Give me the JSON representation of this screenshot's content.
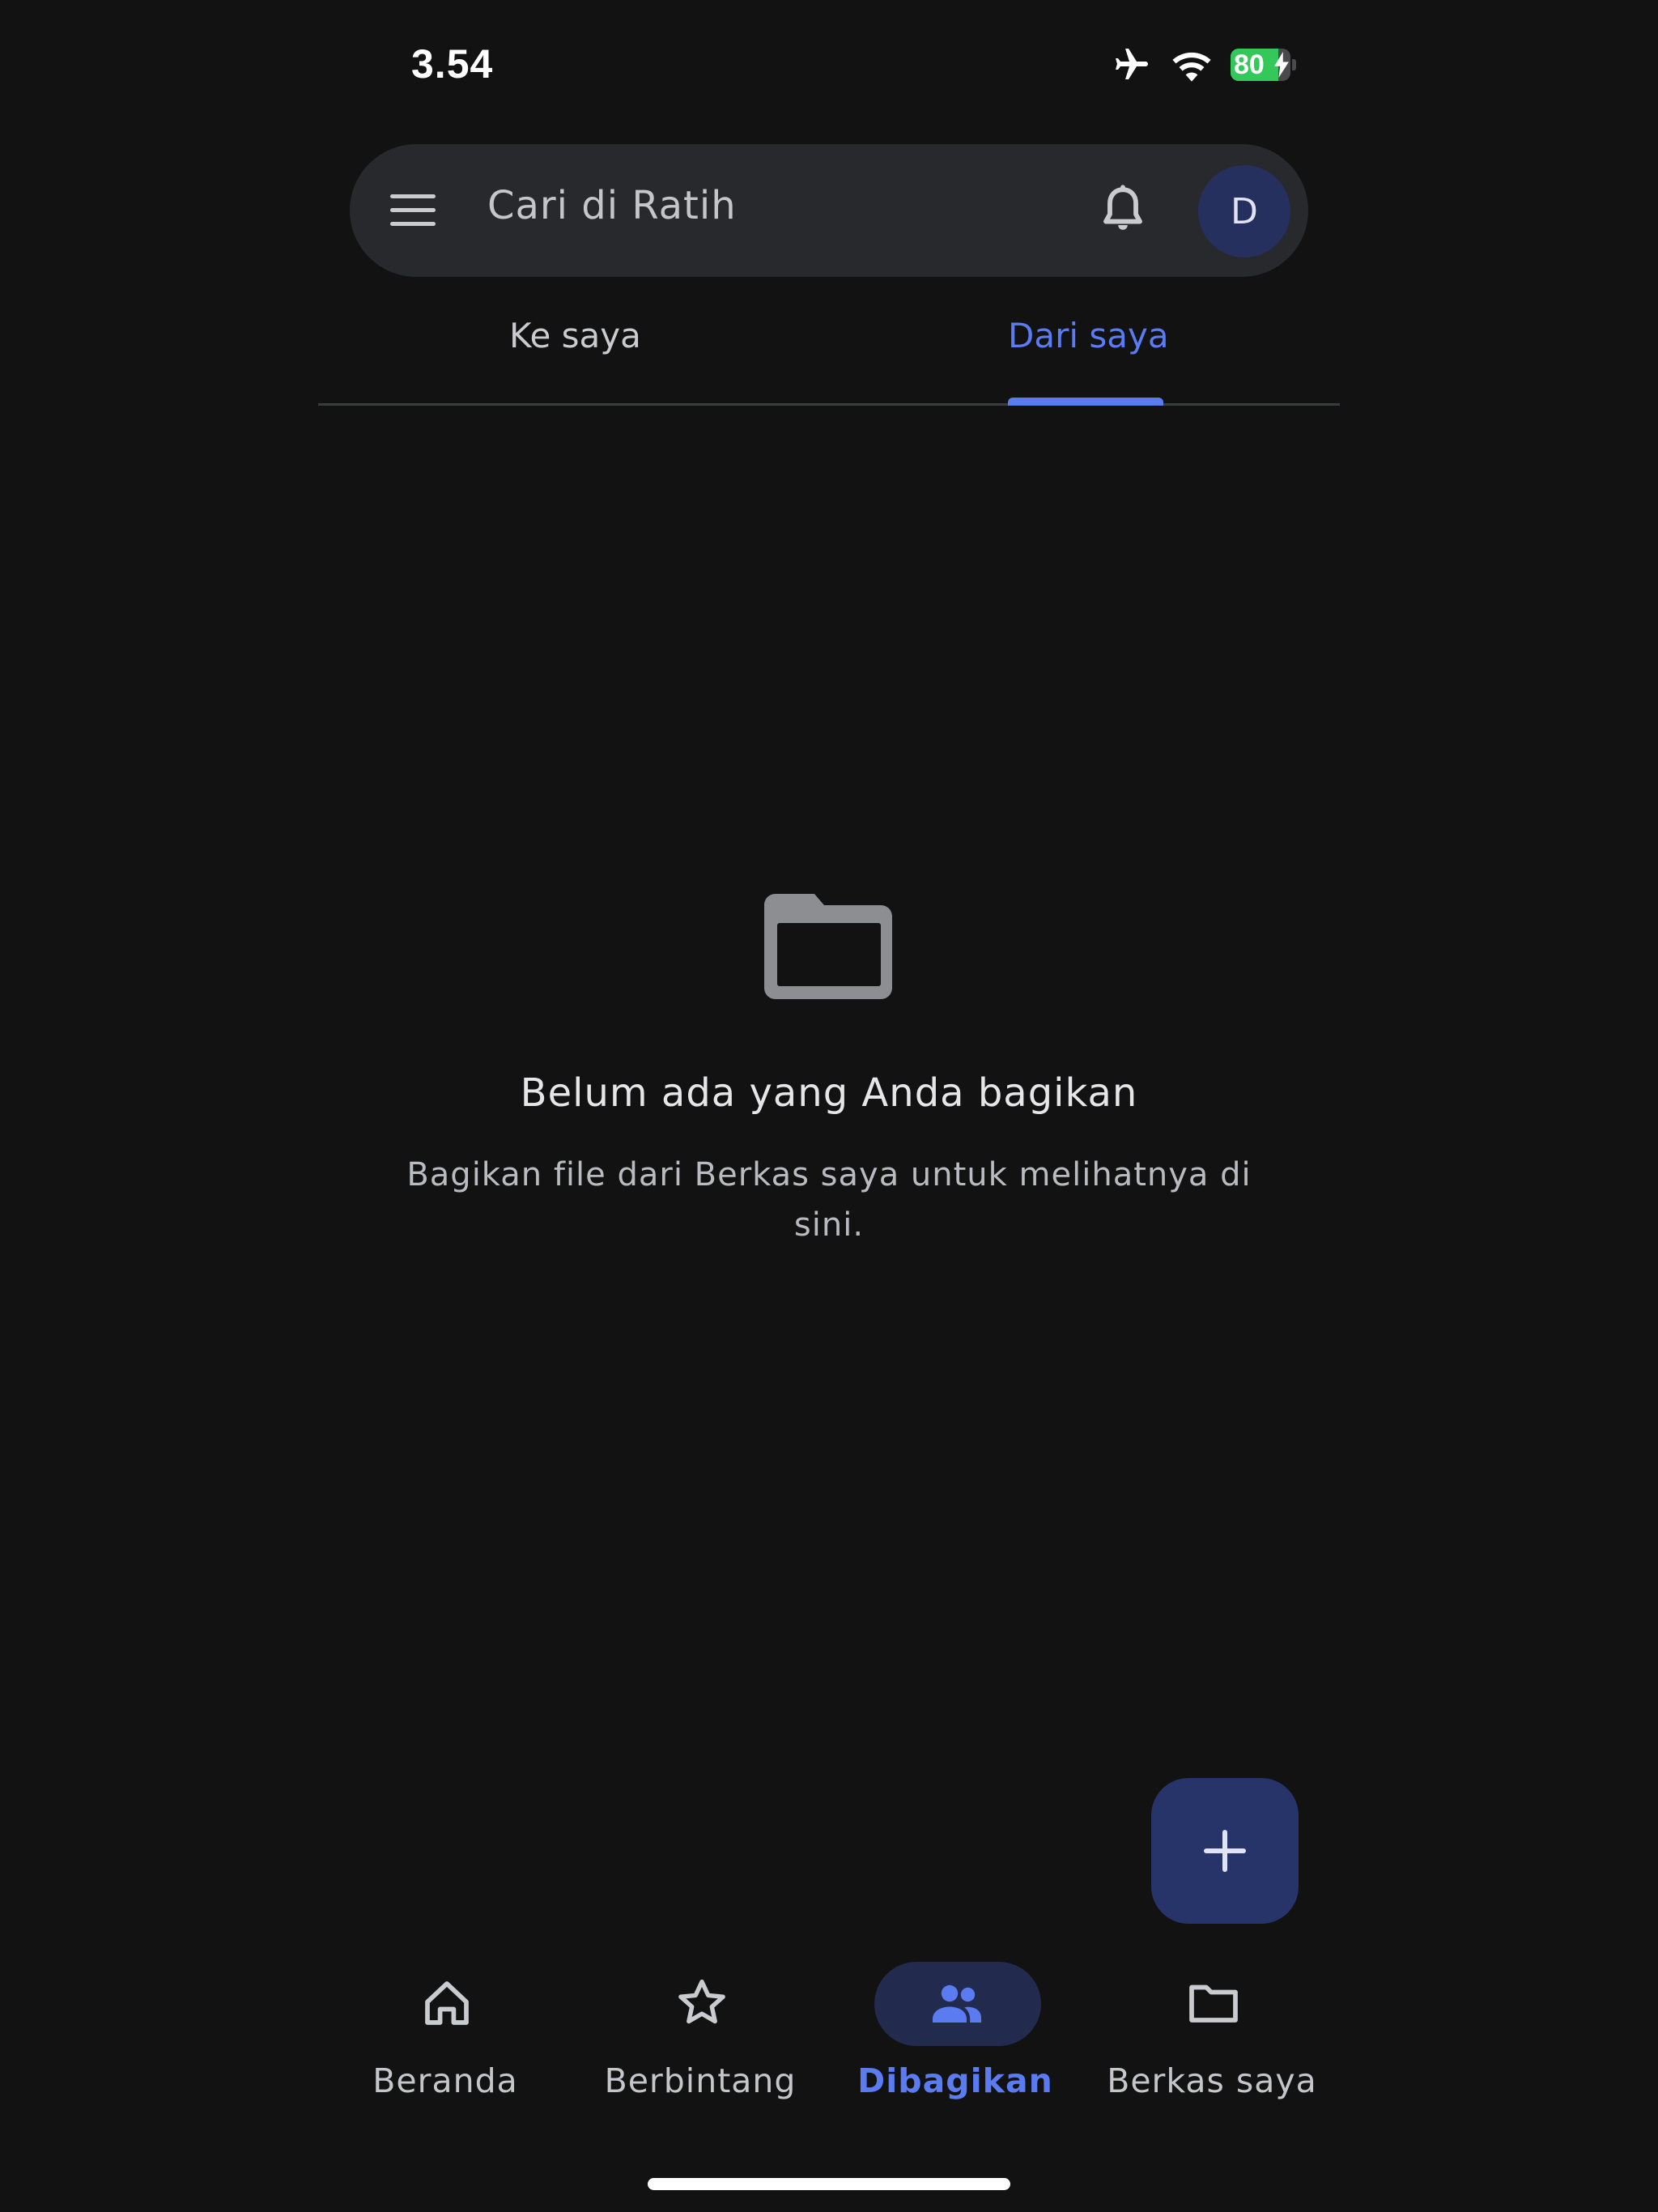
{
  "status_bar": {
    "time": "3.54",
    "battery_level": "80",
    "icons": [
      "airplane-icon",
      "wifi-icon",
      "battery-charging-icon"
    ]
  },
  "search": {
    "placeholder": "Cari di Ratih",
    "avatar_initial": "D",
    "icons": [
      "menu-icon",
      "bell-icon"
    ]
  },
  "tabs": [
    {
      "label": "Ke saya",
      "active": false
    },
    {
      "label": "Dari saya",
      "active": true
    }
  ],
  "empty_state": {
    "icon": "folder-icon",
    "title": "Belum ada yang Anda bagikan",
    "subtitle": "Bagikan file dari Berkas saya untuk melihatnya di sini."
  },
  "fab": {
    "icon": "plus-icon"
  },
  "bottom_nav": {
    "items": [
      {
        "label": "Beranda",
        "icon": "home-icon",
        "active": false
      },
      {
        "label": "Berbintang",
        "icon": "star-icon",
        "active": false
      },
      {
        "label": "Dibagikan",
        "icon": "people-icon",
        "active": true
      },
      {
        "label": "Berkas saya",
        "icon": "folder-icon",
        "active": false
      }
    ]
  },
  "colors": {
    "background": "#121213",
    "accent": "#5b7bf0",
    "surface": "#28292c",
    "fab": "#27346a",
    "nav_pill": "#222a4e",
    "battery": "#34c759"
  }
}
